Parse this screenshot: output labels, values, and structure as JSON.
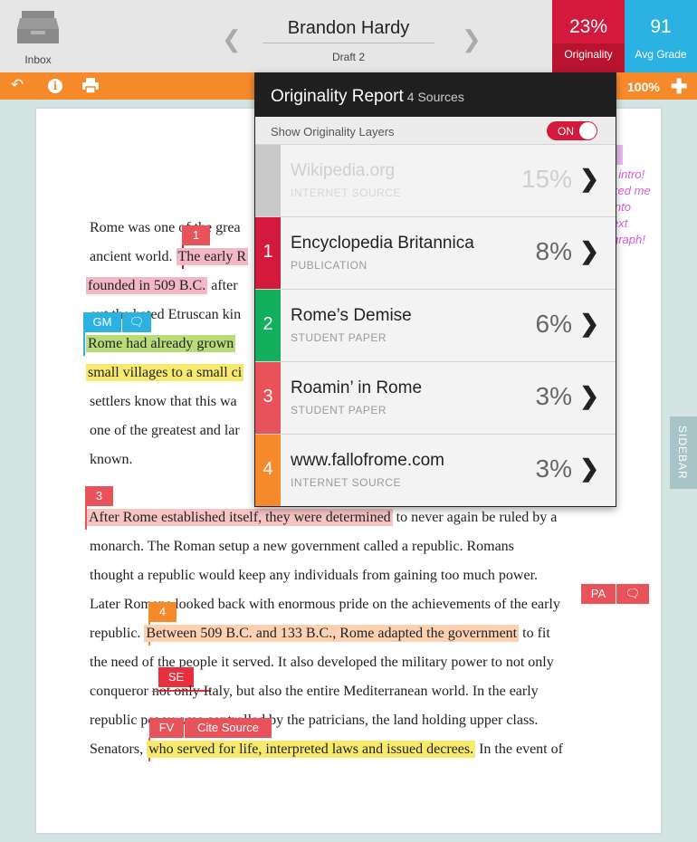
{
  "header": {
    "inbox_label": "Inbox",
    "student_name": "Brandon Hardy",
    "draft": "Draft 2",
    "originality": {
      "value": "23%",
      "label": "Originality"
    },
    "avg_grade": {
      "value": "91",
      "label": "Avg Grade"
    }
  },
  "toolbar": {
    "back_icon": "back-arrow-icon",
    "info_icon": "info-icon",
    "print_icon": "print-icon",
    "zoom": "100%",
    "add_icon": "plus-icon"
  },
  "colors": {
    "originality": "#d41a3c",
    "grade": "#2bb2e2",
    "toolbar": "#f68a2b"
  },
  "report": {
    "title": "Originality Report",
    "sources_count": "4 Sources",
    "toggle_label": "Show Originality Layers",
    "toggle_state": "ON",
    "sources": [
      {
        "num": "",
        "name": "Wikipedia.org",
        "type": "INTERNET SOURCE",
        "pct": "15%",
        "color": "#c9c9c9"
      },
      {
        "num": "1",
        "name": "Encyclopedia Britannica",
        "type": "PUBLICATION",
        "pct": "8%",
        "color": "#d41a3c"
      },
      {
        "num": "2",
        "name": "Rome’s Demise",
        "type": "STUDENT PAPER",
        "pct": "6%",
        "color": "#12b05c"
      },
      {
        "num": "3",
        "name": "Roamin’ in Rome",
        "type": "STUDENT PAPER",
        "pct": "3%",
        "color": "#e8525b"
      },
      {
        "num": "4",
        "name": "www.fallofrome.com",
        "type": "INTERNET SOURCE",
        "pct": "3%",
        "color": "#f68a2b"
      }
    ]
  },
  "document": {
    "lines": [
      {
        "pre": "Rome was one of the grea"
      },
      {
        "pre": "ancient world. ",
        "hl": "The early R"
      },
      {
        "hl": "founded in 509 B.C.",
        "post": " after"
      },
      {
        "pre": "out the hated Etruscan kin"
      },
      {
        "hl": "Rome had already grown"
      },
      {
        "hl": "small villages to a small ci"
      },
      {
        "pre": "settlers know that this wa"
      },
      {
        "pre": "one of the greatest and lar"
      },
      {
        "pre": "known."
      },
      {
        "hl": "After Rome established itself, they were determined",
        "post": " to never again be ruled by a"
      },
      {
        "pre": "monarch. The Roman setup a new government called a republic. Romans"
      },
      {
        "pre": "thought a republic would keep any individuals from gaining too much power."
      },
      {
        "pre": "Later Romans looked back with enormous pride on the achievements of the early"
      },
      {
        "pre": "republic. ",
        "hl": "Between 509 B.C. and 133 B.C., Rome adapted the government",
        "post": " to fit"
      },
      {
        "pre": "the need of the people it served. It also developed the military power to not only"
      },
      {
        "pre": "conqueror ",
        "strike": "not only",
        "post": " Italy, but also the entire Mediterranean world. In the early"
      },
      {
        "pre": "republic power was controlled by the patricians, the land holding upper class."
      },
      {
        "pre": "Senators, ",
        "hl": "who served for life, interpreted laws and issued decrees.",
        "post": " In the event of"
      }
    ],
    "markers": {
      "m1": "1",
      "gm": "GM",
      "m3": "3",
      "m4": "4",
      "pa": "PA",
      "se": "SE",
      "fv": "FV",
      "cite": "Cite Source"
    },
    "margin_note": [
      "t intro!",
      "ked me",
      " into",
      "ext",
      "graph!"
    ],
    "sidebar_label": "SIDEBAR"
  }
}
